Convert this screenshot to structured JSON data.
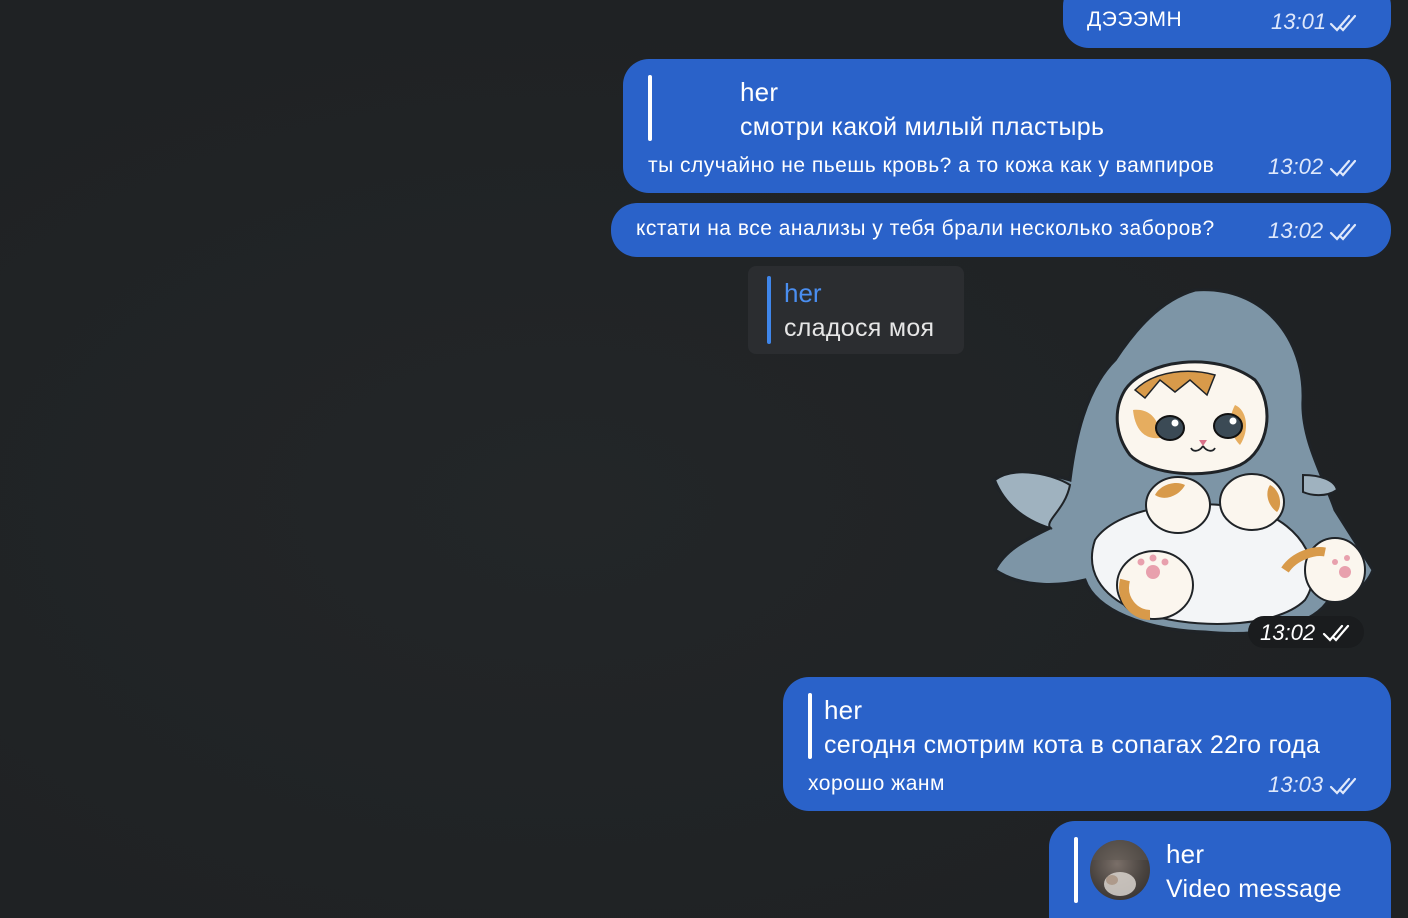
{
  "messages": [
    {
      "id": "m1",
      "text": "ДЭЭЭМН",
      "time": "13:01"
    },
    {
      "id": "m2",
      "reply": {
        "name": "her",
        "text": "смотри какой милый пластырь"
      },
      "text": "ты случайно не пьешь кровь? а то кожа как у вампиров",
      "time": "13:02"
    },
    {
      "id": "m3",
      "text": "кстати на все анализы у тебя брали несколько заборов?",
      "time": "13:02"
    },
    {
      "id": "m4",
      "reply": {
        "name": "her",
        "text": "сладося моя"
      },
      "sticker": "cat-in-shark-costume",
      "time": "13:02"
    },
    {
      "id": "m5",
      "reply": {
        "name": "her",
        "text": "сегодня смотрим кота в сопагах 22го года"
      },
      "text": "хорошо жанм",
      "time": "13:03"
    },
    {
      "id": "m6",
      "reply": {
        "name": "her",
        "text": "Video message"
      }
    }
  ],
  "icons": {
    "read_receipt": "double-check-icon"
  },
  "colors": {
    "background": "#212426",
    "outgoing_bubble": "#2a62c9",
    "quote_name_incoming": "#4a8ef0"
  }
}
